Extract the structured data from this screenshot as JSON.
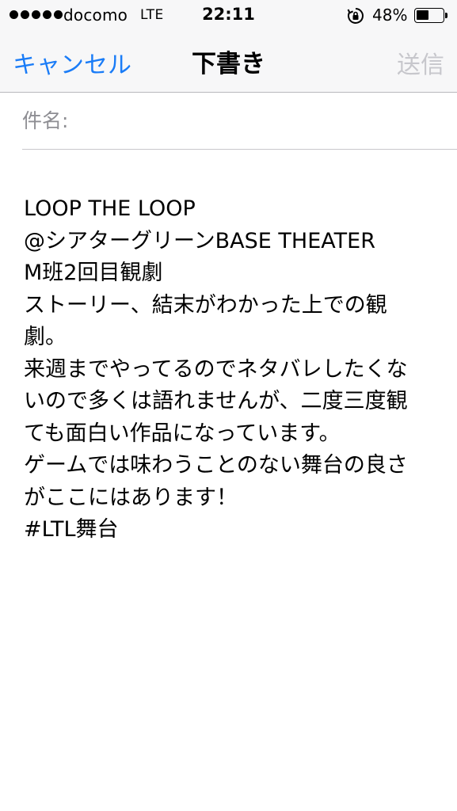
{
  "status_bar": {
    "carrier": "docomo",
    "network": "LTE",
    "time": "22:11",
    "battery_percent_label": "48%",
    "battery_level": 0.48,
    "signal_icon": "signal-dots-icon",
    "rotation_icon": "rotation-lock-icon",
    "battery_icon": "battery-icon"
  },
  "nav": {
    "cancel_label": "キャンセル",
    "title": "下書き",
    "send_label": "送信"
  },
  "subject": {
    "label": "件名:",
    "value": ""
  },
  "body": {
    "lines": [
      " LOOP THE LOOP",
      "@シアターグリーンBASE THEATER",
      "M班2回目観劇",
      "ストーリー、結末がわかった上での観",
      "劇。",
      "来週までやってるのでネタバレしたくな",
      "いので多くは語れませんが、二度三度観",
      "ても面白い作品になっています。",
      "ゲームでは味わうことのない舞台の良さ",
      "がここにはあります！",
      "#LTL舞台"
    ]
  },
  "colors": {
    "accent": "#1a7cf7",
    "disabled": "#c7c7cc",
    "nav_background": "#f7f7f8",
    "placeholder": "#8e8e93"
  }
}
